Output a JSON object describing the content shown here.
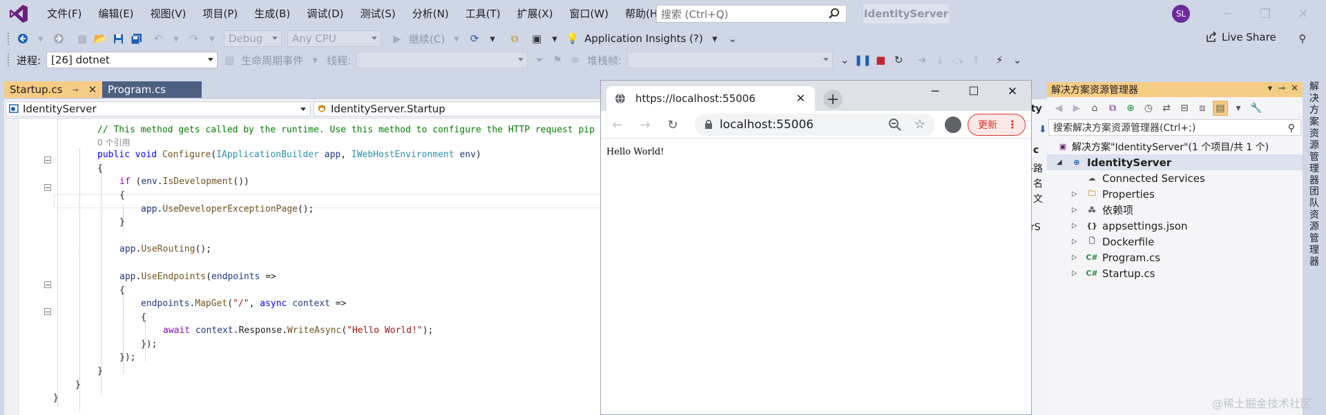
{
  "menu": [
    "文件(F)",
    "编辑(E)",
    "视图(V)",
    "项目(P)",
    "生成(B)",
    "调试(D)",
    "测试(S)",
    "分析(N)",
    "工具(T)",
    "扩展(X)",
    "窗口(W)",
    "帮助(H)"
  ],
  "search": {
    "placeholder": "搜索 (Ctrl+Q)"
  },
  "solution_name": "IdentityServer",
  "user_initials": "SL",
  "toolbar": {
    "config": "Debug",
    "platform": "Any CPU",
    "continue_label": "继续(C)",
    "app_insights": "Application Insights (?)",
    "live_share": "Live Share"
  },
  "debug_toolbar": {
    "process_label": "进程:",
    "process_value": "[26] dotnet",
    "lifecycle_label": "生命周期事件",
    "thread_label": "线程:",
    "stack_label": "堆栈帧:"
  },
  "editor": {
    "tabs": [
      {
        "label": "Startup.cs",
        "active": true
      },
      {
        "label": "Program.cs",
        "active": false
      }
    ],
    "nav_project": "IdentityServer",
    "nav_class": "IdentityServer.Startup",
    "code": {
      "l1": "// This method gets called by the runtime. Use this method to configure the HTTP request pip",
      "refs": "0 个引用",
      "l3_kw1": "public",
      "l3_kw2": "void",
      "l3_method": "Configure",
      "l3_type1": "IApplicationBuilder",
      "l3_param1": "app",
      "l3_type2": "IWebHostEnvironment",
      "l3_param2": "env",
      "if_kw": "if",
      "if_env": "env",
      "if_method": "IsDevelopment",
      "app": "app",
      "use_dev": "UseDeveloperExceptionPage",
      "use_routing": "UseRouting",
      "use_endpoints": "UseEndpoints",
      "endpoints": "endpoints",
      "map_get": "MapGet",
      "route": "\"/\"",
      "async_kw": "async",
      "context": "context",
      "await_kw": "await",
      "response": "Response",
      "write_async": "WriteAsync",
      "hello_str": "\"Hello World!\""
    }
  },
  "browser": {
    "tab_title": "https://localhost:55006",
    "address": "localhost:55006",
    "update_label": "更新",
    "content": "Hello World!"
  },
  "hidden_panel_fragments": [
    "ity",
    "c",
    "各路",
    "名",
    "文",
    "rS"
  ],
  "solution_explorer": {
    "title": "解决方案资源管理器",
    "search_placeholder": "搜索解决方案资源管理器(Ctrl+;)",
    "solution_row": "解决方案\"IdentityServer\"(1 个项目/共 1 个)",
    "project_row": "IdentityServer",
    "items": [
      "Connected Services",
      "Properties",
      "依赖项",
      "appsettings.json",
      "Dockerfile",
      "Program.cs",
      "Startup.cs"
    ]
  },
  "side_tabs": [
    "解决方案资源管理器",
    "团队资源管理器"
  ],
  "watermark": "@稀土掘金技术社区",
  "colors": {
    "accent_tab": "#f5cc84",
    "vs_purple": "#68217a",
    "chrome_update": "#d93025"
  }
}
